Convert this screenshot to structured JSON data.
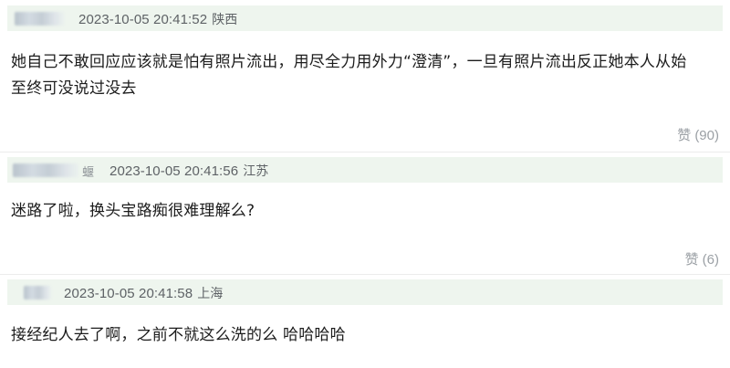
{
  "comments": [
    {
      "timestamp": "2023-10-05 20:41:52",
      "location": "陕西",
      "text_line1": "她自己不敢回应应该就是怕有照片流出，用尽全力用外力“澄清”，一旦有照片流出反正她本人从始",
      "text_line2": "至终可没说过没去",
      "like_label": "赞",
      "like_count": "(90)"
    },
    {
      "timestamp": "2023-10-05 20:41:56",
      "location": "江苏",
      "username_tail": "蝘",
      "text_line1": "迷路了啦，换头宝路痴很难理解么?",
      "like_label": "赞",
      "like_count": "(6)"
    },
    {
      "timestamp": "2023-10-05 20:41:58",
      "location": "上海",
      "text_line1": "接经纪人去了啊，之前不就这么洗的么 哈哈哈哈"
    }
  ]
}
